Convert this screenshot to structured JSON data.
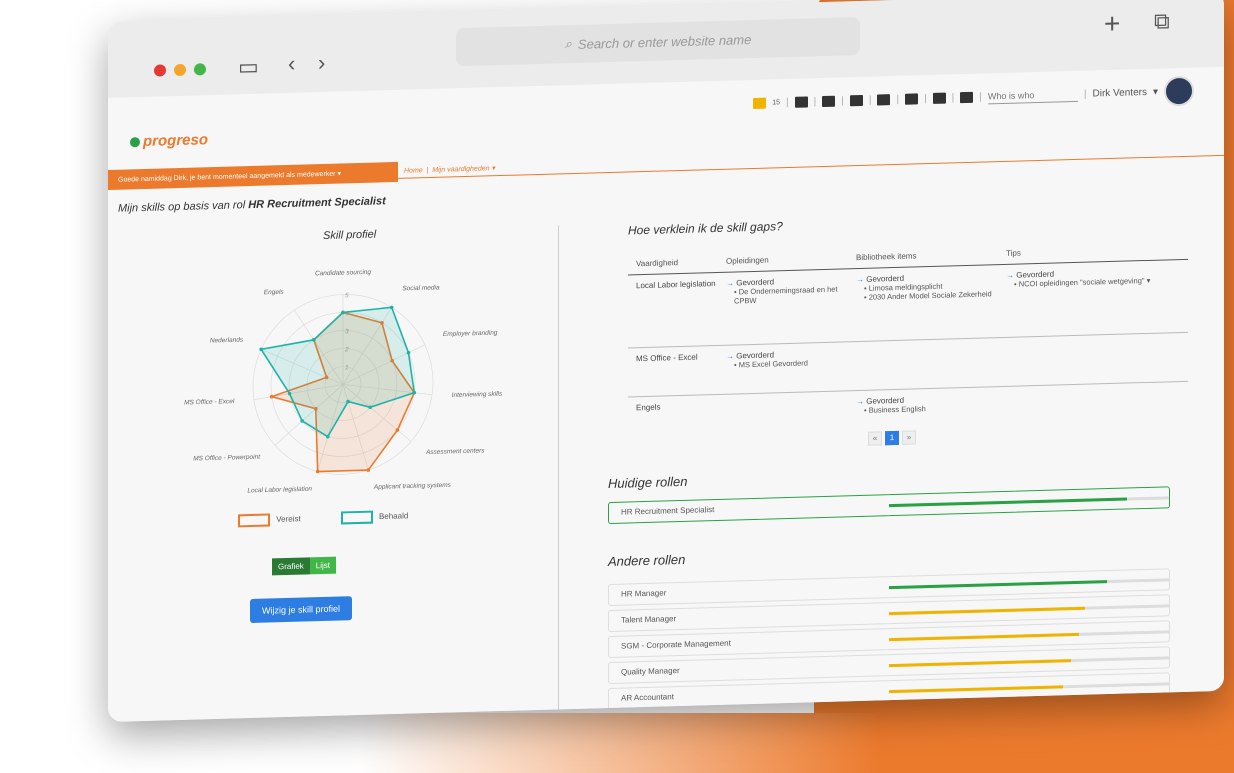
{
  "browser": {
    "address_placeholder": "Search or enter website name"
  },
  "topbar": {
    "notification_count": "15",
    "search_placeholder": "Who is who",
    "user_name": "Dirk Venters"
  },
  "app": {
    "logo_text": "progreso",
    "greeting": "Goede namiddag Dirk, je bent momenteel aangemeld als medewerker",
    "breadcrumb_home": "Home",
    "breadcrumb_current": "Mijn vaardigheden",
    "page_heading_prefix": "Mijn skills op basis van rol",
    "page_heading_role": "HR Recruitment Specialist"
  },
  "skill_profile": {
    "title": "Skill profiel",
    "legend_required": "Vereist",
    "legend_achieved": "Behaald",
    "toggle_chart": "Grafiek",
    "toggle_list": "Lijst",
    "edit_button": "Wijzig je skill profiel",
    "colors": {
      "required": "#ec7a2d",
      "achieved": "#1fb3a8"
    }
  },
  "chart_data": {
    "type": "radar",
    "axes": [
      "Candidate sourcing",
      "Social media",
      "Employer branding",
      "Interviewing skills",
      "Assessment centers",
      "Applicant tracking systems",
      "Local Labor legislation",
      "MS Office - Powerpoint",
      "MS Office - Excel",
      "Nederlands",
      "Engels"
    ],
    "tick_labels": [
      "1",
      "2",
      "3",
      "4",
      "5"
    ],
    "rlim": [
      0,
      5
    ],
    "series": [
      {
        "name": "Vereist",
        "values": [
          4,
          4,
          3,
          4,
          4,
          5,
          5,
          2,
          4,
          1,
          3
        ]
      },
      {
        "name": "Behaald",
        "values": [
          4,
          5,
          4,
          4,
          2,
          1,
          3,
          3,
          3,
          5,
          3
        ]
      }
    ]
  },
  "skill_gaps": {
    "title": "Hoe verklein ik de skill gaps?",
    "headers": [
      "Vaardigheid",
      "Opleidingen",
      "Bibliotheek items",
      "Tips"
    ],
    "rows": [
      {
        "skill": "Local Labor legislation",
        "opleidingen_status": "Gevorderd",
        "opleidingen_items": [
          "De Ondernemingsraad en het CPBW"
        ],
        "bib_status": "Gevorderd",
        "bib_items": [
          "Limosa meldingsplicht",
          "2030 Ander Model Sociale Zekerheid"
        ],
        "tips_status": "Gevorderd",
        "tips_items": [
          "NCOI opleidingen \"sociale wetgeving\""
        ]
      },
      {
        "skill": "MS Office - Excel",
        "opleidingen_status": "Gevorderd",
        "opleidingen_items": [
          "MS Excel Gevorderd"
        ]
      },
      {
        "skill": "Engels",
        "bib_status": "Gevorderd",
        "bib_items": [
          "Business English"
        ]
      }
    ],
    "pager": [
      "«",
      "1",
      "»"
    ]
  },
  "current_roles": {
    "title": "Huidige rollen",
    "items": [
      {
        "name": "HR Recruitment Specialist",
        "progress": 0.85,
        "color": "#2aa145"
      }
    ]
  },
  "other_roles": {
    "title": "Andere rollen",
    "items": [
      {
        "name": "HR Manager",
        "progress": 0.78,
        "color": "#2aa145"
      },
      {
        "name": "Talent Manager",
        "progress": 0.7,
        "color": "#f0b400"
      },
      {
        "name": "SGM - Corporate Management",
        "progress": 0.68,
        "color": "#f0b400"
      },
      {
        "name": "Quality Manager",
        "progress": 0.65,
        "color": "#f0b400"
      },
      {
        "name": "AR Accountant",
        "progress": 0.62,
        "color": "#f0b400"
      }
    ]
  }
}
